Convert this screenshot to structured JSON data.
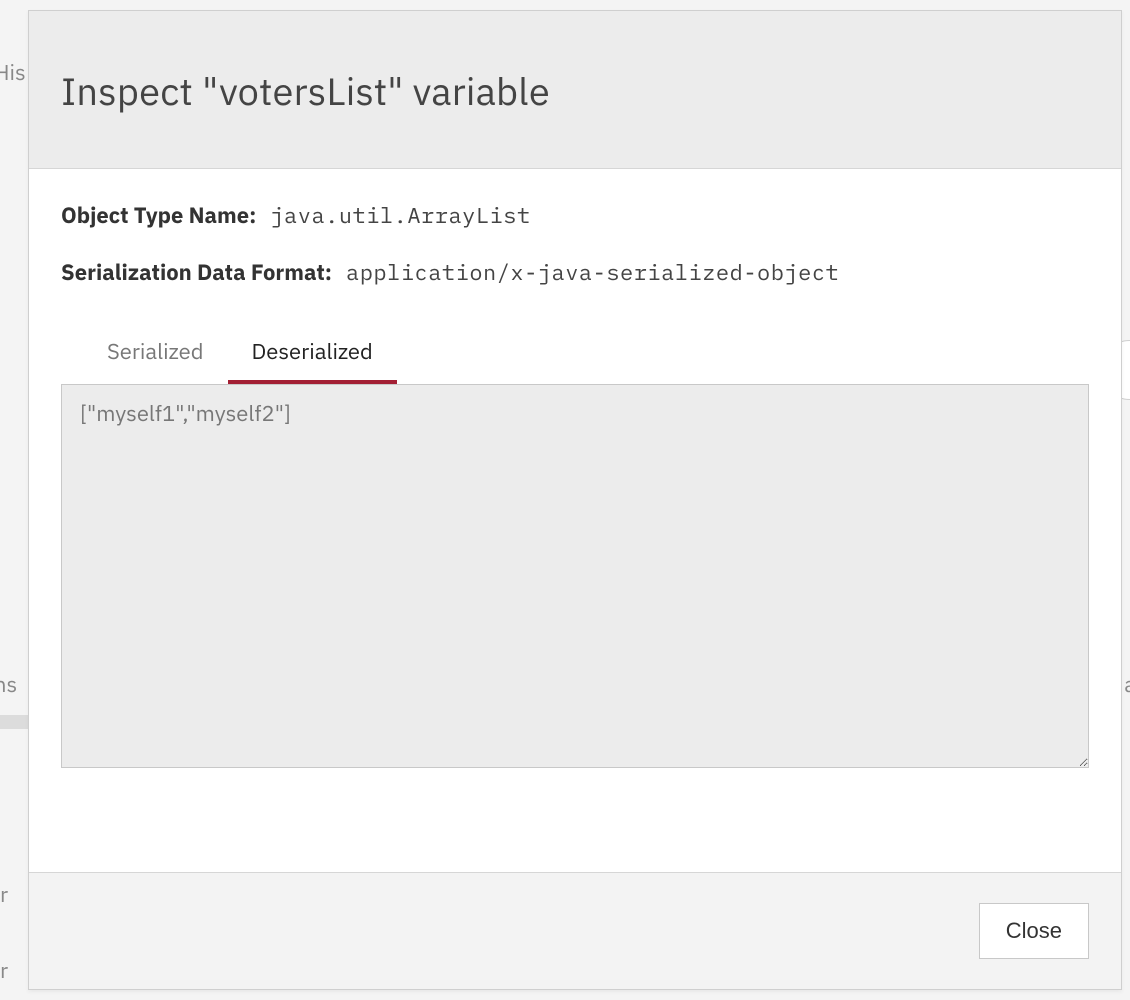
{
  "background": {
    "hint1": "His",
    "hint2": "ns",
    "hint3": "r",
    "hint4": "r",
    "hintRight": "a"
  },
  "modal": {
    "title": "Inspect \"votersList\" variable",
    "fields": {
      "objectTypeLabel": "Object Type Name:",
      "objectTypeValue": "java.util.ArrayList",
      "serFormatLabel": "Serialization Data Format:",
      "serFormatValue": "application/x-java-serialized-object"
    },
    "tabs": {
      "serialized": "Serialized",
      "deserialized": "Deserialized",
      "active": "deserialized"
    },
    "content": "[\"myself1\",\"myself2\"]",
    "footer": {
      "close": "Close"
    }
  }
}
